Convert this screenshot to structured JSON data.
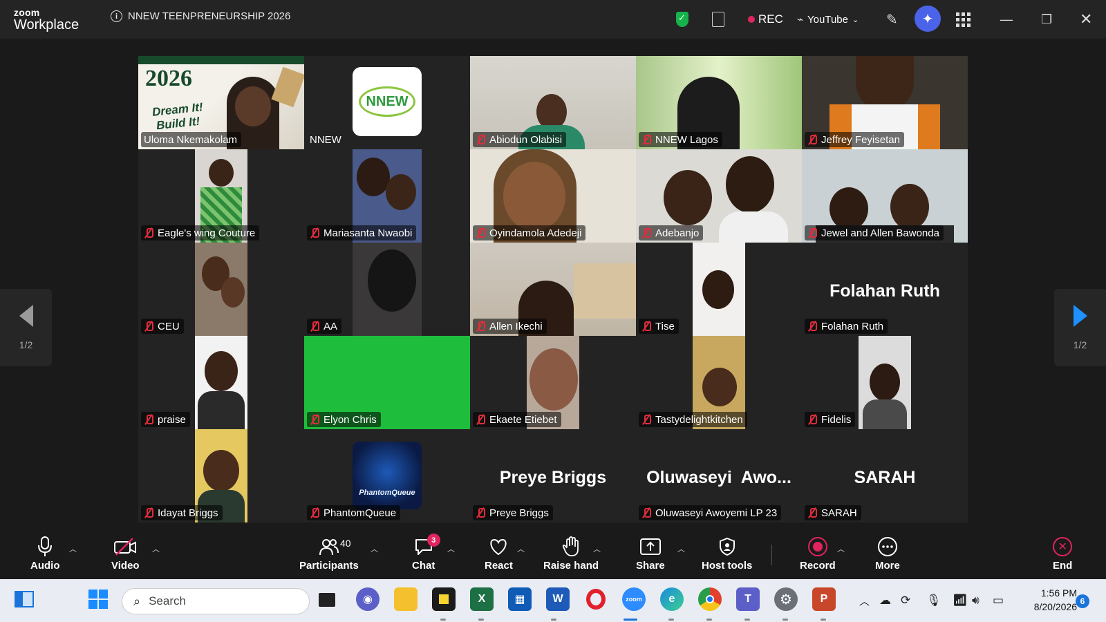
{
  "app": {
    "brand_small": "zoom",
    "brand_big": "Workplace",
    "meeting_title": "NNEW TEENPRENEURSHIP 2026",
    "rec_label": "REC",
    "stream_label": "YouTube"
  },
  "gallery": {
    "page_left": "1/2",
    "page_right": "1/2",
    "tiles": [
      {
        "name": "Uloma Nkemakolam"
      },
      {
        "name": "NNEW",
        "logo": "NNEW"
      },
      {
        "name": "Abiodun Olabisi"
      },
      {
        "name": "NNEW Lagos"
      },
      {
        "name": "Jeffrey Feyisetan"
      },
      {
        "name": "Eagle's wing Couture"
      },
      {
        "name": "Mariasanta Nwaobi"
      },
      {
        "name": "Oyindamola Adedeji"
      },
      {
        "name": "Adebanjo"
      },
      {
        "name": "Jewel and Allen Bawonda"
      },
      {
        "name": "CEU"
      },
      {
        "name": "AA"
      },
      {
        "name": "Allen Ikechi"
      },
      {
        "name": "Tise"
      },
      {
        "name": "Folahan Ruth",
        "big": "Folahan Ruth"
      },
      {
        "name": "praise"
      },
      {
        "name": "Elyon Chris"
      },
      {
        "name": "Ekaete Etiebet"
      },
      {
        "name": "Tastydelightkitchen"
      },
      {
        "name": "Fidelis"
      },
      {
        "name": "Idayat Briggs"
      },
      {
        "name": "PhantomQueue",
        "logo": "PhantomQueue"
      },
      {
        "name": "Preye Briggs",
        "big": "Preye Briggs"
      },
      {
        "name": "Oluwaseyi Awoyemi LP 23",
        "big": "Oluwaseyi  Awo..."
      },
      {
        "name": "SARAH",
        "big": "SARAH"
      }
    ],
    "poster_text": {
      "year": "2026",
      "line1": "Dream It!",
      "line2": "Build It!"
    }
  },
  "toolbar": {
    "audio": "Audio",
    "video": "Video",
    "participants": "Participants",
    "participants_count": "40",
    "chat": "Chat",
    "chat_badge": "3",
    "react": "React",
    "raise_hand": "Raise hand",
    "share": "Share",
    "host_tools": "Host tools",
    "record": "Record",
    "more": "More",
    "end": "End"
  },
  "taskbar": {
    "search_placeholder": "Search",
    "time": "1:56 PM",
    "date": "8/20/2026",
    "notification_count": "6"
  },
  "colors": {
    "accent_green": "#20c05a",
    "elyon_green": "#1fbd3c",
    "record_red": "#e0245e",
    "ai_blue": "#4b63e8"
  }
}
